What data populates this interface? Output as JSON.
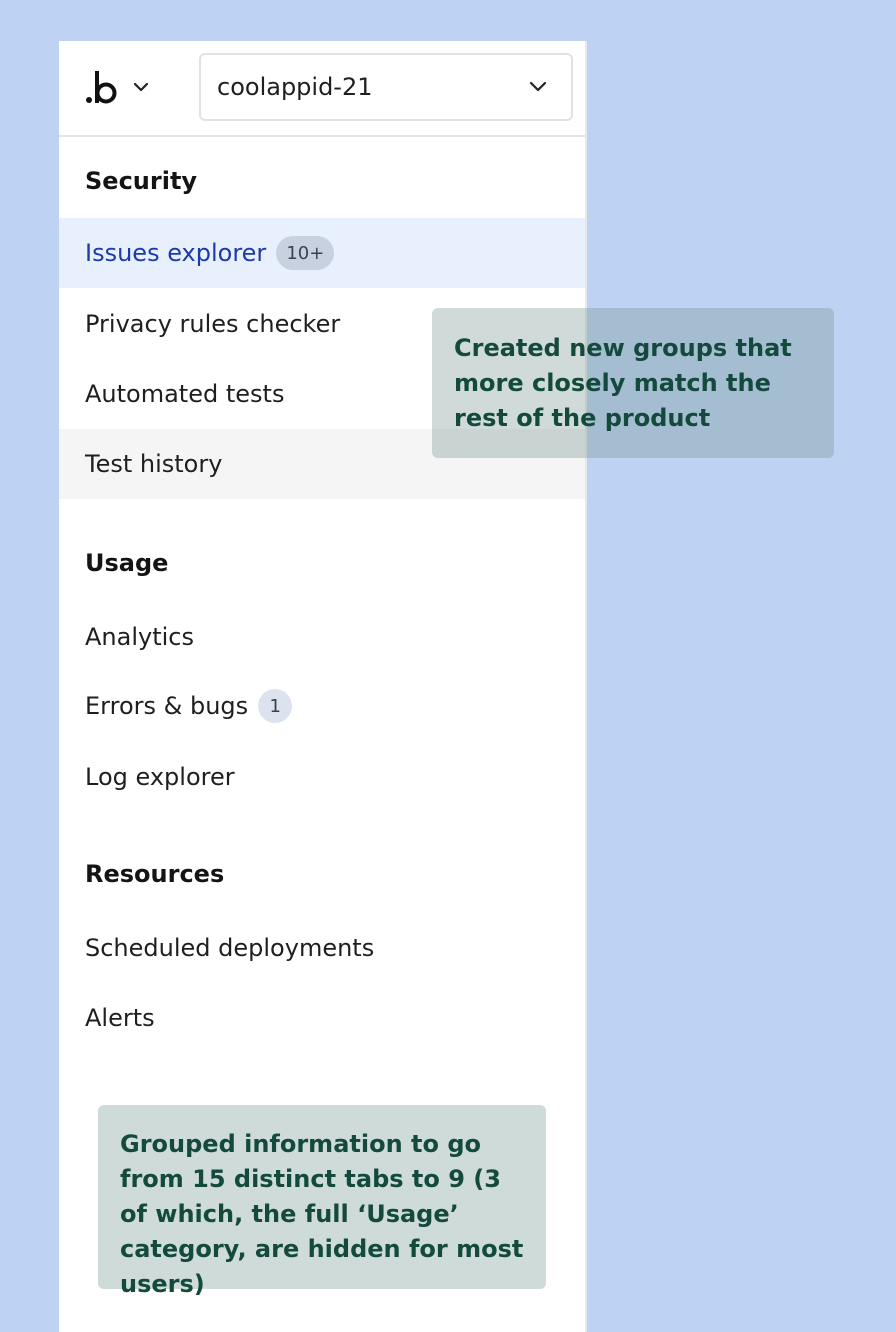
{
  "header": {
    "logo_icon": "brand-logo-icon",
    "app_selector": {
      "value": "coolappid-21",
      "icon": "chevron-down-icon"
    }
  },
  "sections": {
    "security": {
      "title": "Security",
      "items": [
        {
          "label": "Issues explorer",
          "badge": "10+",
          "state": "active"
        },
        {
          "label": "Privacy rules checker"
        },
        {
          "label": "Automated tests"
        },
        {
          "label": "Test history",
          "state": "hover"
        }
      ]
    },
    "usage": {
      "title": "Usage",
      "items": [
        {
          "label": "Analytics"
        },
        {
          "label": "Errors & bugs",
          "badge": "1"
        },
        {
          "label": "Log explorer"
        }
      ]
    },
    "resources": {
      "title": "Resources",
      "items": [
        {
          "label": "Scheduled deployments"
        },
        {
          "label": "Alerts"
        }
      ]
    }
  },
  "annotations": {
    "groups_note": "Created new groups that more closely match the rest of the product",
    "grouping_note": "Grouped information to go from 15 distinct tabs to 9 (3 of which, the full ‘Usage’ category, are hidden for most users)"
  },
  "colors": {
    "background": "#bed3f3",
    "active_bg": "#e8f0fd",
    "active_text": "#1b3ba8",
    "note_text": "#144a3e"
  }
}
